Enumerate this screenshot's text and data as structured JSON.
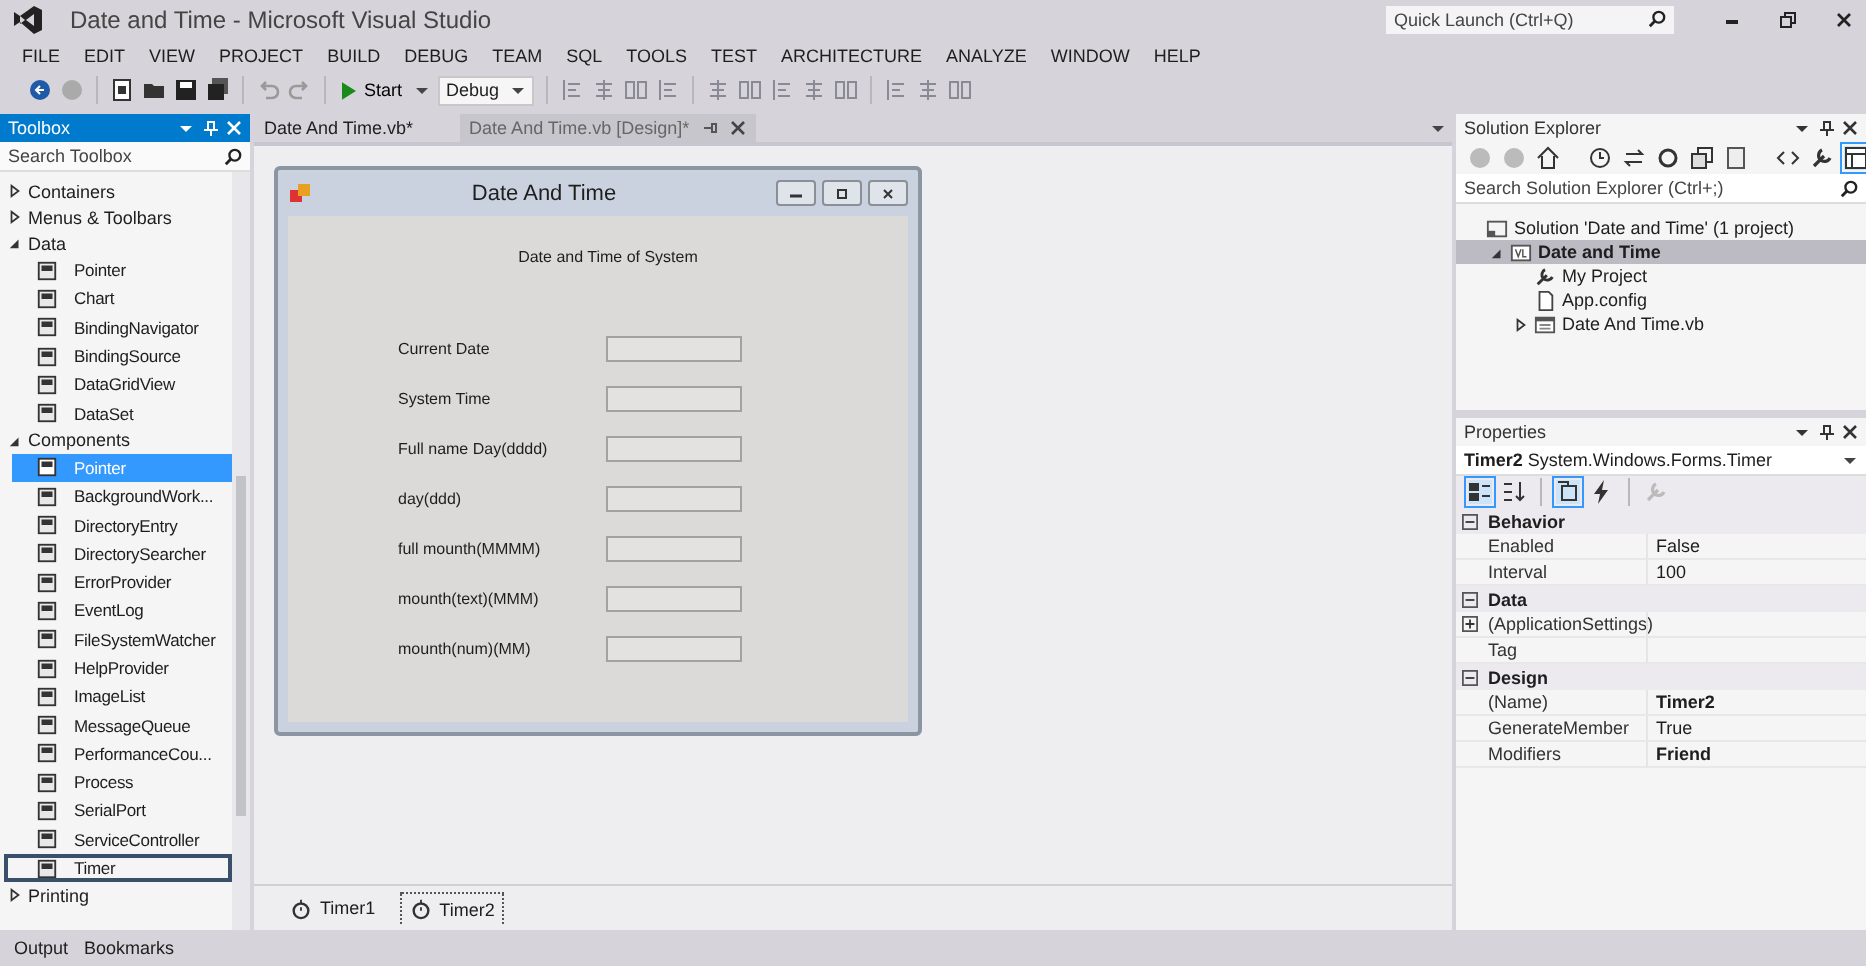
{
  "window": {
    "title": "Date and Time - Microsoft Visual Studio"
  },
  "quick_launch": {
    "placeholder": "Quick Launch (Ctrl+Q)"
  },
  "menu": [
    "FILE",
    "EDIT",
    "VIEW",
    "PROJECT",
    "BUILD",
    "DEBUG",
    "TEAM",
    "SQL",
    "TOOLS",
    "TEST",
    "ARCHITECTURE",
    "ANALYZE",
    "WINDOW",
    "HELP"
  ],
  "toolbar": {
    "start": "Start",
    "configuration": "Debug"
  },
  "toolbox": {
    "title": "Toolbox",
    "search_placeholder": "Search Toolbox",
    "groups": [
      {
        "label": "Containers",
        "expanded": false
      },
      {
        "label": "Menus & Toolbars",
        "expanded": false
      },
      {
        "label": "Data",
        "expanded": true,
        "items": [
          {
            "label": "Pointer",
            "selected": false,
            "outlined": false
          },
          {
            "label": "Chart",
            "selected": false,
            "outlined": false
          },
          {
            "label": "BindingNavigator",
            "selected": false,
            "outlined": false
          },
          {
            "label": "BindingSource",
            "selected": false,
            "outlined": false
          },
          {
            "label": "DataGridView",
            "selected": false,
            "outlined": false
          },
          {
            "label": "DataSet",
            "selected": false,
            "outlined": false
          }
        ]
      },
      {
        "label": "Components",
        "expanded": true,
        "items": [
          {
            "label": "Pointer",
            "selected": true,
            "outlined": false
          },
          {
            "label": "BackgroundWork...",
            "selected": false,
            "outlined": false
          },
          {
            "label": "DirectoryEntry",
            "selected": false,
            "outlined": false
          },
          {
            "label": "DirectorySearcher",
            "selected": false,
            "outlined": false
          },
          {
            "label": "ErrorProvider",
            "selected": false,
            "outlined": false
          },
          {
            "label": "EventLog",
            "selected": false,
            "outlined": false
          },
          {
            "label": "FileSystemWatcher",
            "selected": false,
            "outlined": false
          },
          {
            "label": "HelpProvider",
            "selected": false,
            "outlined": false
          },
          {
            "label": "ImageList",
            "selected": false,
            "outlined": false
          },
          {
            "label": "MessageQueue",
            "selected": false,
            "outlined": false
          },
          {
            "label": "PerformanceCou...",
            "selected": false,
            "outlined": false
          },
          {
            "label": "Process",
            "selected": false,
            "outlined": false
          },
          {
            "label": "SerialPort",
            "selected": false,
            "outlined": false
          },
          {
            "label": "ServiceController",
            "selected": false,
            "outlined": false
          },
          {
            "label": "Timer",
            "selected": false,
            "outlined": true
          }
        ]
      },
      {
        "label": "Printing",
        "expanded": false
      }
    ]
  },
  "editor_tabs": [
    {
      "label": "Date And Time.vb*",
      "selected": false
    },
    {
      "label": "Date And Time.vb [Design]*",
      "selected": true
    }
  ],
  "form": {
    "title": "Date And Time",
    "heading": "Date and Time of System",
    "fields": [
      {
        "label": "Current Date"
      },
      {
        "label": "System Time"
      },
      {
        "label": "Full name Day(dddd)"
      },
      {
        "label": "day(ddd)"
      },
      {
        "label": "full mounth(MMMM)"
      },
      {
        "label": "mounth(text)(MMM)"
      },
      {
        "label": "mounth(num)(MM)"
      }
    ]
  },
  "component_tray": [
    {
      "label": "Timer1",
      "selected": false
    },
    {
      "label": "Timer2",
      "selected": true
    }
  ],
  "solution_explorer": {
    "title": "Solution Explorer",
    "search_placeholder": "Search Solution Explorer (Ctrl+;)",
    "tree": [
      {
        "label": "Solution 'Date and Time' (1 project)",
        "kind": "solution",
        "selected": false,
        "children": [
          {
            "label": "Date and Time",
            "kind": "project",
            "selected": true,
            "expanded": true,
            "children": [
              {
                "label": "My Project",
                "kind": "settings",
                "selected": false
              },
              {
                "label": "App.config",
                "kind": "config",
                "selected": false
              },
              {
                "label": "Date And Time.vb",
                "kind": "form",
                "selected": false,
                "expanded": false
              }
            ]
          }
        ]
      }
    ]
  },
  "properties": {
    "title": "Properties",
    "object_name": "Timer2",
    "object_type": "System.Windows.Forms.Timer",
    "categories": [
      {
        "name": "Behavior",
        "expanded": true,
        "properties": [
          {
            "name": "Enabled",
            "value": "False",
            "bold": false
          },
          {
            "name": "Interval",
            "value": "100",
            "bold": false
          }
        ]
      },
      {
        "name": "Data",
        "expanded": true,
        "properties": [
          {
            "name": "(ApplicationSettings)",
            "expanded": false
          },
          {
            "name": "Tag"
          }
        ]
      },
      {
        "name": "Design",
        "expanded": true,
        "properties": [
          {
            "name": "(Name)",
            "value": "Timer2",
            "bold": true
          },
          {
            "name": "GenerateMember",
            "value": "True",
            "bold": false
          },
          {
            "name": "Modifiers",
            "value": "Friend",
            "bold": true
          }
        ]
      }
    ]
  },
  "bottom_tabs": [
    "Output",
    "Bookmarks"
  ]
}
